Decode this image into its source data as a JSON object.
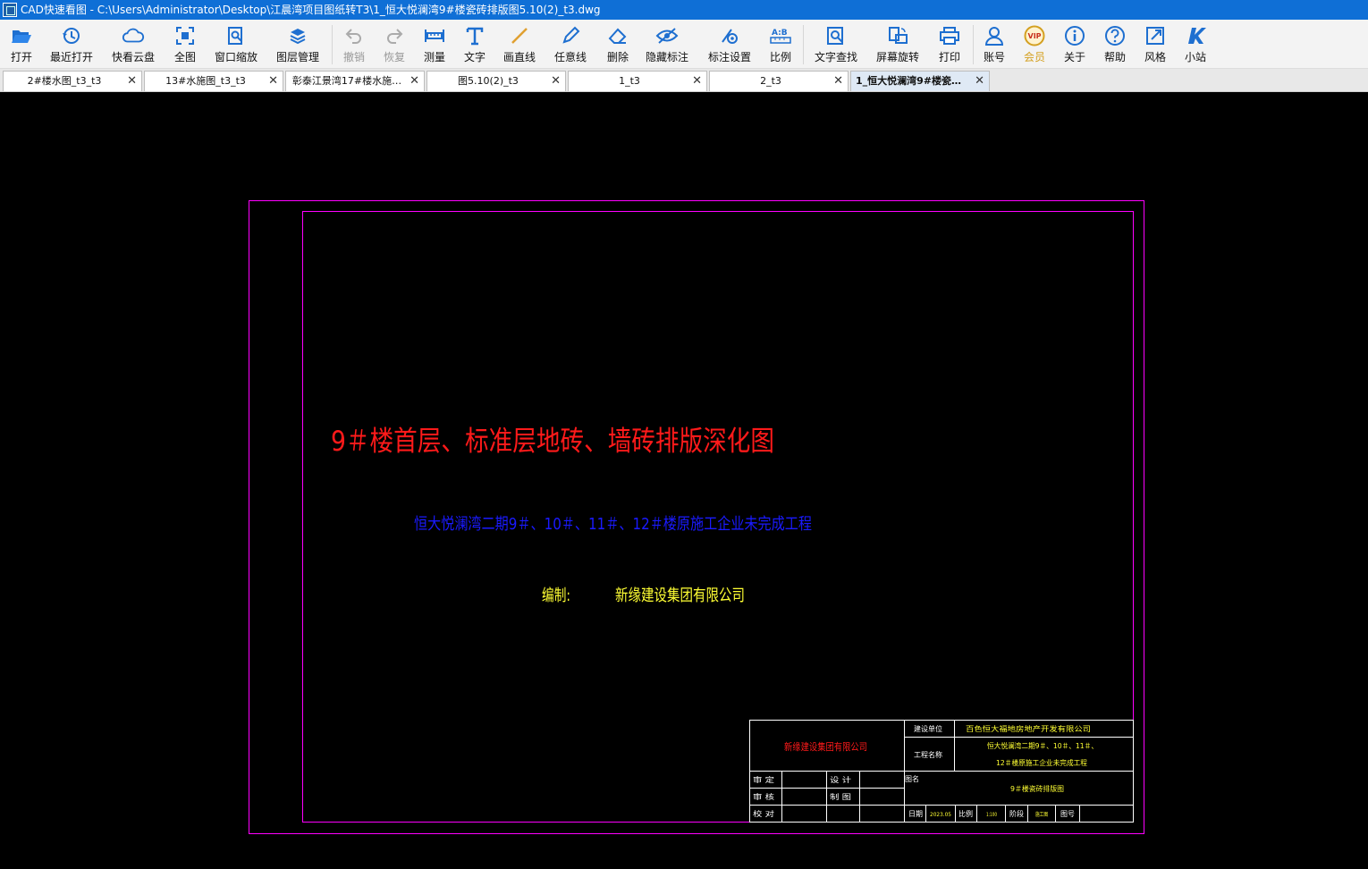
{
  "window": {
    "title": "CAD快速看图 - C:\\Users\\Administrator\\Desktop\\江晨湾项目图纸转T3\\1_恒大悦澜湾9#楼瓷砖排版图5.10(2)_t3.dwg"
  },
  "toolbar": {
    "buttons": [
      {
        "label": "打开",
        "icon": "folder-open-icon"
      },
      {
        "label": "最近打开",
        "icon": "history-icon"
      },
      {
        "label": "快看云盘",
        "icon": "cloud-icon"
      },
      {
        "label": "全图",
        "icon": "fit-all-icon"
      },
      {
        "label": "窗口缩放",
        "icon": "zoom-window-icon"
      },
      {
        "label": "图层管理",
        "icon": "layers-icon"
      },
      {
        "label": "撤销",
        "icon": "undo-icon",
        "disabled": true
      },
      {
        "label": "恢复",
        "icon": "redo-icon",
        "disabled": true
      },
      {
        "label": "测量",
        "icon": "ruler-icon"
      },
      {
        "label": "文字",
        "icon": "text-icon"
      },
      {
        "label": "画直线",
        "icon": "line-icon"
      },
      {
        "label": "任意线",
        "icon": "pen-icon"
      },
      {
        "label": "删除",
        "icon": "eraser-icon"
      },
      {
        "label": "隐藏标注",
        "icon": "eye-hide-icon"
      },
      {
        "label": "标注设置",
        "icon": "dimension-settings-icon"
      },
      {
        "label": "比例",
        "icon": "scale-icon"
      },
      {
        "label": "文字查找",
        "icon": "text-search-icon"
      },
      {
        "label": "屏幕旋转",
        "icon": "rotate-screen-icon"
      },
      {
        "label": "打印",
        "icon": "printer-icon"
      },
      {
        "label": "账号",
        "icon": "user-icon"
      },
      {
        "label": "会员",
        "icon": "vip-icon"
      },
      {
        "label": "关于",
        "icon": "info-icon"
      },
      {
        "label": "帮助",
        "icon": "help-icon"
      },
      {
        "label": "风格",
        "icon": "style-icon"
      },
      {
        "label": "小站",
        "icon": "site-icon"
      }
    ]
  },
  "tabs": [
    {
      "label": "2#楼水图_t3_t3"
    },
    {
      "label": "13#水施图_t3_t3"
    },
    {
      "label": "彰泰江景湾17#楼水施…"
    },
    {
      "label": "图5.10(2)_t3"
    },
    {
      "label": "1_t3"
    },
    {
      "label": "2_t3"
    },
    {
      "label": "1_恒大悦澜湾9#楼瓷…",
      "active": true
    }
  ],
  "drawing": {
    "main_title": "9＃楼首层、标准层地砖、墙砖排版深化图",
    "project_line": "恒大悦澜湾二期9＃、10＃、11＃、12＃楼原施工企业未完成工程",
    "compiled_by_label": "编制:",
    "compiled_by_company": "新缘建设集团有限公司",
    "colors": {
      "title": "#ff1a1a",
      "project": "#1a1aff",
      "compiler": "#ffff33",
      "frame": "#ff00ff",
      "titleblock": "#ffffff"
    },
    "title_block": {
      "company": "新缘建设集团有限公司",
      "owner_label": "建设单位",
      "owner_value": "百色恒大福地房地产开发有限公司",
      "project_label": "工程名称",
      "project_value_1": "恒大悦澜湾二期9＃、10＃、11＃、",
      "project_value_2": "12＃楼原施工企业未完成工程",
      "approve_label": "审  定",
      "review_label": "审  核",
      "check_label": "校  对",
      "design_label": "设  计",
      "draw_label": "制  图",
      "drawing_name_label": "图名",
      "drawing_name_value": "9＃楼瓷砖排版图",
      "date_label": "日期",
      "date_value": "2023.05",
      "scale_label": "比例",
      "scale_value": "1:100",
      "stage_label": "阶段",
      "stage_value": "施工图",
      "sheet_label": "图号"
    }
  }
}
